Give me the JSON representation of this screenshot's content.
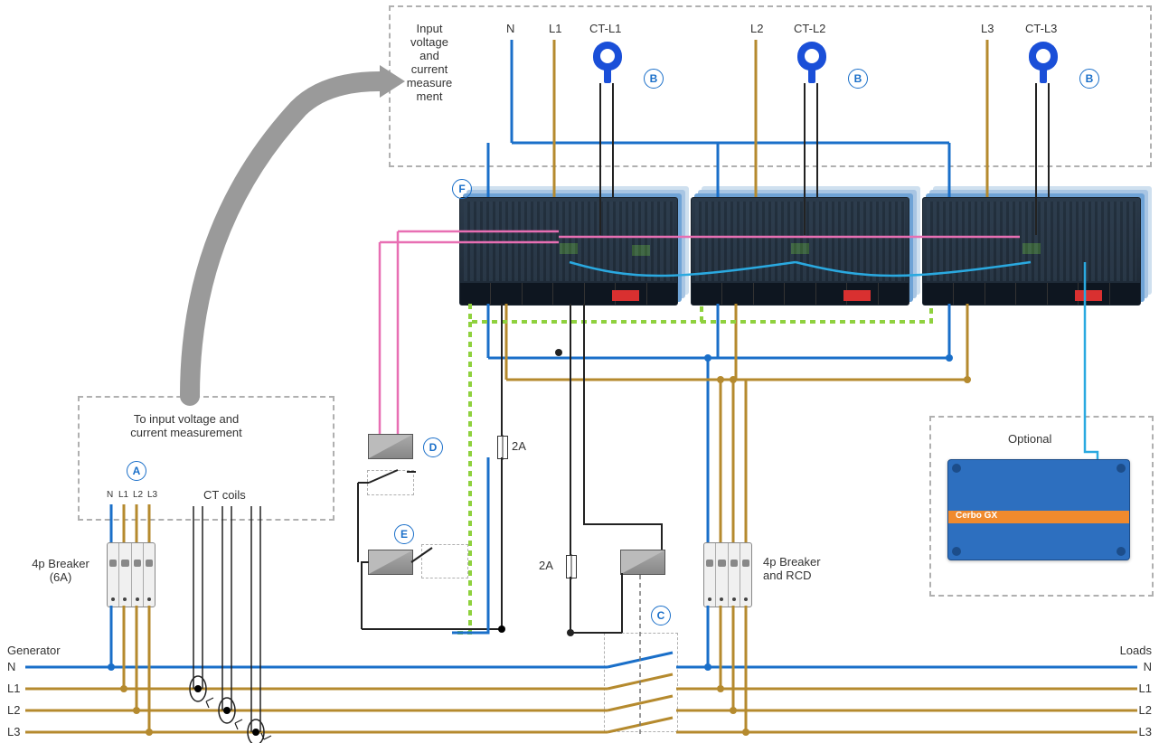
{
  "diagram": {
    "top_box_title": "Input\nvoltage\nand\ncurrent\nmeasure\nment",
    "top_terminals": {
      "N": "N",
      "L1": "L1",
      "CTL1": "CT-L1",
      "L2": "L2",
      "CTL2": "CT-L2",
      "L3": "L3",
      "CTL3": "CT-L3"
    },
    "left_box_title": "To input voltage and\ncurrent measurement",
    "small_terminals": {
      "N": "N",
      "L1": "L1",
      "L2": "L2",
      "L3": "L3"
    },
    "ct_coils_label": "CT coils",
    "breaker_left_label": "4p Breaker\n(6A)",
    "breaker_right_label": "4p Breaker\nand RCD",
    "optional_label": "Optional",
    "cerbo_label": "Cerbo GX",
    "fuse1_label": "2A",
    "fuse2_label": "2A",
    "generator_label": "Generator",
    "loads_label": "Loads",
    "bus": {
      "N": "N",
      "L1": "L1",
      "L2": "L2",
      "L3": "L3"
    },
    "markers": {
      "A": "A",
      "B": "B",
      "C": "C",
      "D": "D",
      "E": "E",
      "F": "F"
    }
  },
  "colors": {
    "neutral": "#1a6fc9",
    "phase": "#b58a2e",
    "ground": "#8fd13e",
    "pink": "#e86fb3",
    "black": "#222",
    "cyan": "#2aa9e0"
  }
}
